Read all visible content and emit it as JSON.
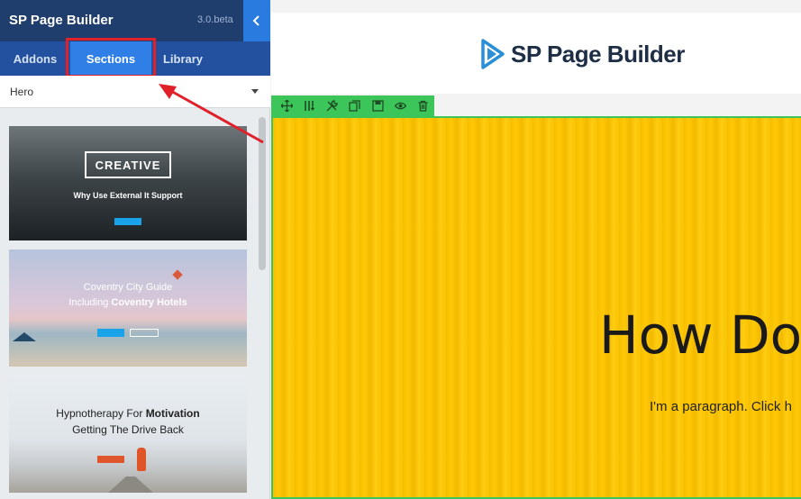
{
  "panel": {
    "title": "SP Page Builder",
    "version": "3.0.beta",
    "collapse_icon": "chevron-left-icon",
    "tabs": [
      {
        "label": "Addons",
        "active": false
      },
      {
        "label": "Sections",
        "active": true
      },
      {
        "label": "Library",
        "active": false
      }
    ],
    "category_select": {
      "value": "Hero"
    }
  },
  "templates": [
    {
      "box_text": "CREATIVE",
      "heading": "Why Use External It Support"
    },
    {
      "line1": "Coventry City Guide",
      "line2_prefix": "Including",
      "line2_bold": "Coventry Hotels"
    },
    {
      "line1_prefix": "Hypnotherapy For",
      "line1_bold": "Motivation",
      "line2": "Getting The Drive Back"
    }
  ],
  "canvas": {
    "logo_text": "SP Page Builder",
    "toolbar_icons": [
      "move-icon",
      "columns-icon",
      "settings-icon",
      "duplicate-icon",
      "save-icon",
      "visibility-icon",
      "delete-icon"
    ],
    "hero": {
      "heading": "How Do",
      "paragraph": "I'm a paragraph. Click h"
    }
  },
  "colors": {
    "header_bg": "#1f3d6d",
    "tabs_bg": "#2351a0",
    "active_tab": "#2f7fe6",
    "annotation_red": "#e12129",
    "toolbar_green": "#3cc65a",
    "hero_yellow": "#ffc907"
  }
}
